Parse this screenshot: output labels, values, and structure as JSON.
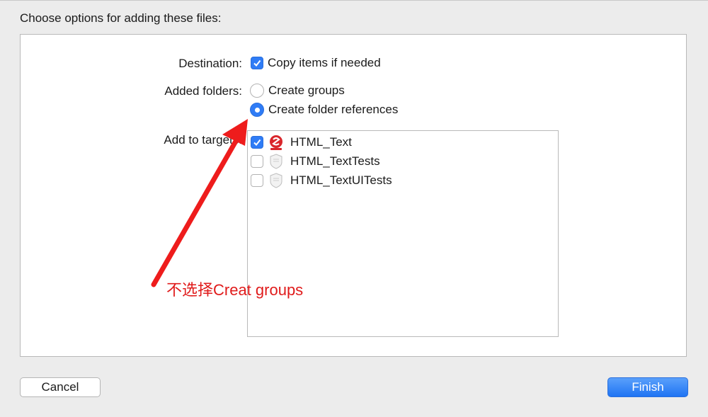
{
  "dialog": {
    "heading": "Choose options for adding these files:",
    "destination": {
      "label": "Destination:",
      "option": "Copy items if needed",
      "checked": true
    },
    "added_folders": {
      "label": "Added folders:",
      "options": [
        {
          "label": "Create groups",
          "selected": false
        },
        {
          "label": "Create folder references",
          "selected": true
        }
      ]
    },
    "targets": {
      "label": "Add to targets:",
      "items": [
        {
          "name": "HTML_Text",
          "checked": true,
          "icon": "app-target-icon"
        },
        {
          "name": "HTML_TextTests",
          "checked": false,
          "icon": "test-bundle-icon"
        },
        {
          "name": "HTML_TextUITests",
          "checked": false,
          "icon": "test-bundle-icon"
        }
      ]
    },
    "buttons": {
      "cancel": "Cancel",
      "finish": "Finish"
    }
  },
  "annotation": {
    "text": "不选择Creat groups",
    "color": "#e01b1b"
  },
  "colors": {
    "accent": "#2f7cf6",
    "annotation": "#e01b1b"
  }
}
